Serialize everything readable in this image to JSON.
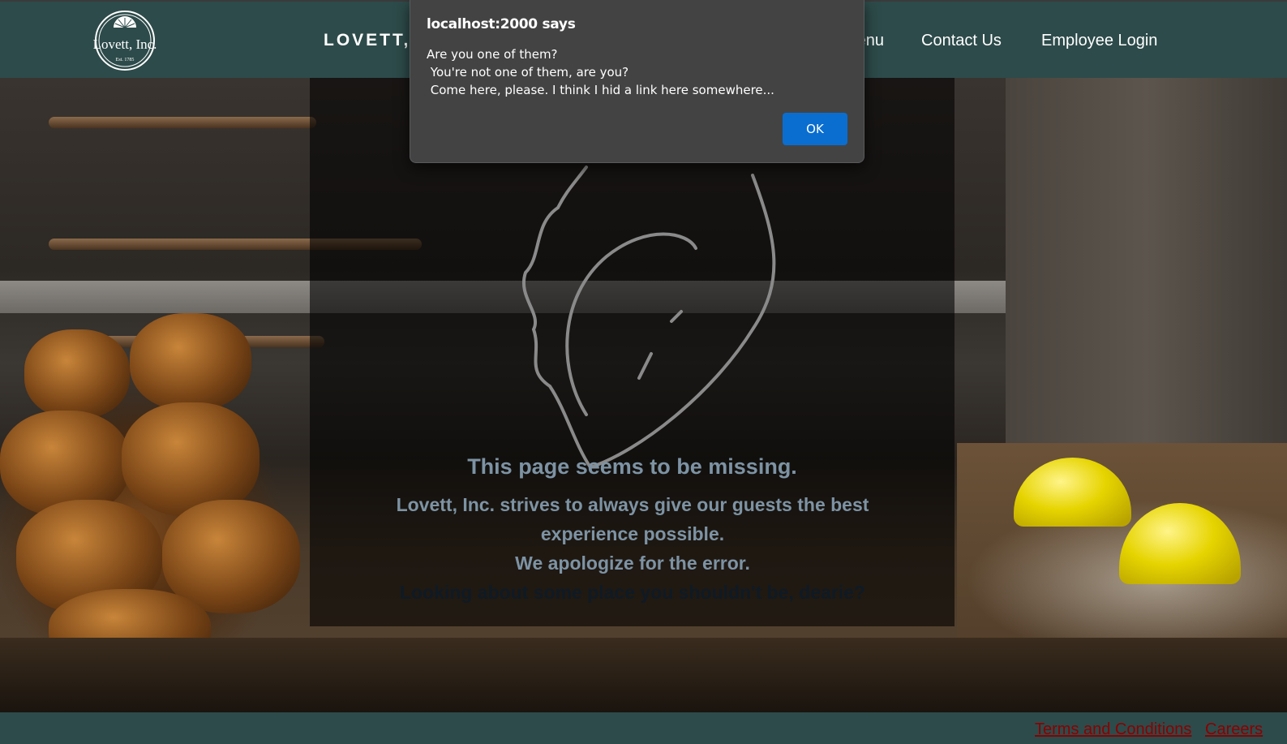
{
  "header": {
    "logo_text": "Lovett, Inc.",
    "logo_est": "Est. 1785",
    "brand": "LOVETT, INC.",
    "nav": [
      {
        "label": "Menu"
      },
      {
        "label": "Contact Us"
      },
      {
        "label": "Employee Login"
      }
    ]
  },
  "main": {
    "title": "This page seems to be missing.",
    "line1": "Lovett, Inc. strives to always give our guests the best",
    "line2": "experience possible.",
    "line3": "We apologize for the error.",
    "hint": "Looking about some place you shouldn't be, dearie?"
  },
  "footer": {
    "terms": "Terms and Conditions",
    "careers": "Careers"
  },
  "dialog": {
    "title": "localhost:2000 says",
    "message": "Are you one of them?\n You're not one of them, are you?\n Come here, please. I think I hid a link here somewhere...",
    "ok": "OK"
  },
  "colors": {
    "header_bg": "#2d4b4a",
    "link_red": "#8b0000",
    "message_text": "#7d93a4",
    "dialog_bg": "#434343",
    "ok_button": "#0a6ed1"
  }
}
